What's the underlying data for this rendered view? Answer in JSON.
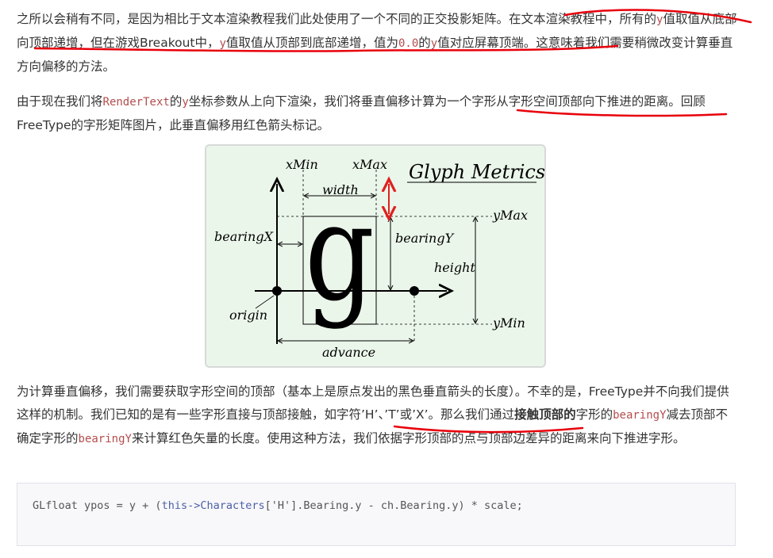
{
  "paragraph1": {
    "text_a": "之所以会稍有不同，是因为相比于文本渲染教程我们此处使用了一个不同的正交投影矩阵。在文本渲染教程中，所有的",
    "code_y1": "y",
    "text_b": "值取值从底部向顶部递增，但在游戏Breakout中，",
    "code_y2": "y",
    "text_c": "值取值从顶部到底部递增，值为",
    "code_zero": "0.0",
    "text_d": "的",
    "code_y3": "y",
    "text_e": "值对应屏幕顶端。这意味着我们需要稍微改变计算垂直方向偏移的方法。"
  },
  "paragraph2": {
    "text_a": "由于现在我们将",
    "code_render": "RenderText",
    "text_b": "的",
    "code_y": "y",
    "text_c": "坐标参数从上向下渲染，我们将垂直偏移计算为一个字形从字形空间顶部向下推进的距离。回顾FreeType的字形矩阵图片，此垂直偏移用红色箭头标记。"
  },
  "figure": {
    "title": "Glyph Metrics",
    "glyph": "g",
    "labels": {
      "xmin": "xMin",
      "xmax": "xMax",
      "width": "width",
      "bearingx": "bearingX",
      "bearingy": "bearingY",
      "ymax": "yMax",
      "ymin": "yMin",
      "height": "height",
      "origin": "origin",
      "advance": "advance"
    },
    "colors": {
      "arrow_red": "#e02020",
      "background": "#ebf6ea"
    }
  },
  "paragraph3": {
    "text_a": "为计算垂直偏移，我们需要获取字形空间的顶部（基本上是原点发出的黑色垂直箭头的长度）。不幸的是，FreeType并不向我们提供这样的机制。我们已知的是有一些字形直接与顶部接触，如字符’H’、’T’或’X’。那么我们通过",
    "bold": "接触顶部的",
    "text_b": "字形的",
    "code_b1": "bearingY",
    "text_c": "减去顶部不确定字形的",
    "code_b2": "bearingY",
    "text_d": "来计算红色矢量的长度。使用这种方法，我们依据字形顶部的点与顶部边差异的距离来向下推进字形。"
  },
  "code_block": {
    "part1": "GLfloat ypos = y + (",
    "kw_this": "this",
    "op": "->",
    "member": "Characters",
    "part2": "['H'].Bearing.y - ch.Bearing.y) * scale;"
  },
  "annotation_color": "#e8000b"
}
